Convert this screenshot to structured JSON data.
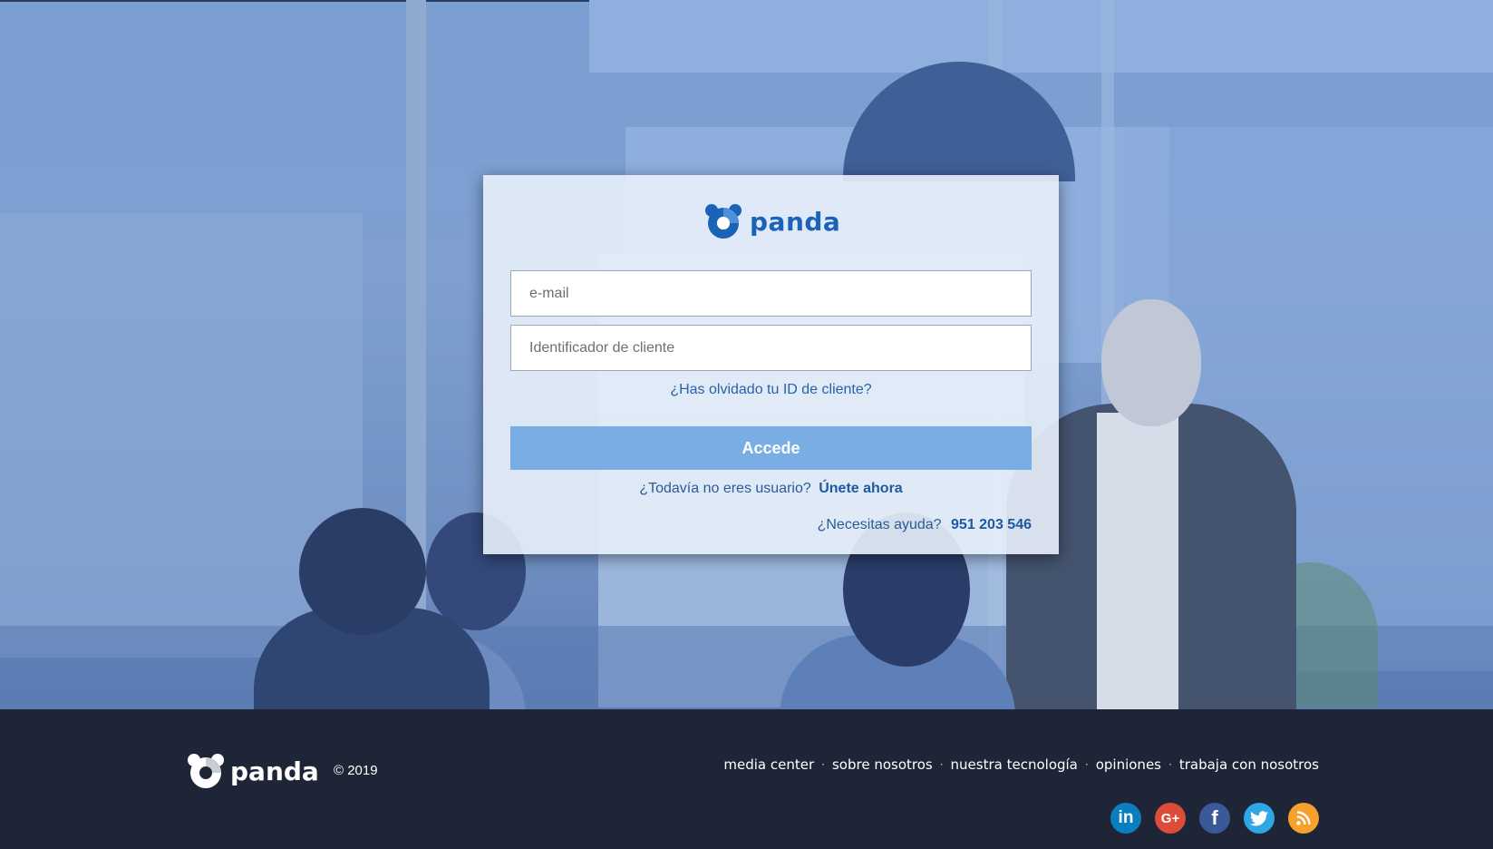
{
  "login": {
    "brand": "panda",
    "email_placeholder": "e-mail",
    "client_id_placeholder": "Identificador de cliente",
    "forgot_link": "¿Has olvidado tu ID de cliente?",
    "submit_label": "Accede",
    "signup_prompt": "¿Todavía no eres usuario?",
    "signup_link": "Únete ahora",
    "help_prompt": "¿Necesitas ayuda?",
    "help_phone": "951 203 546"
  },
  "footer": {
    "brand": "panda",
    "copyright": "© 2019",
    "links": [
      "media center",
      "sobre nosotros",
      "nuestra tecnología",
      "opiniones",
      "trabaja con nosotros"
    ],
    "social": [
      {
        "name": "linkedin-icon",
        "glyph": "in"
      },
      {
        "name": "google-plus-icon",
        "glyph": "G+"
      },
      {
        "name": "facebook-icon",
        "glyph": "f"
      },
      {
        "name": "twitter-icon",
        "glyph": ""
      },
      {
        "name": "rss-icon",
        "glyph": ""
      }
    ]
  },
  "colors": {
    "brand_blue": "#1a63b7",
    "button": "#79ade3",
    "footer_bg": "#1e2536"
  }
}
